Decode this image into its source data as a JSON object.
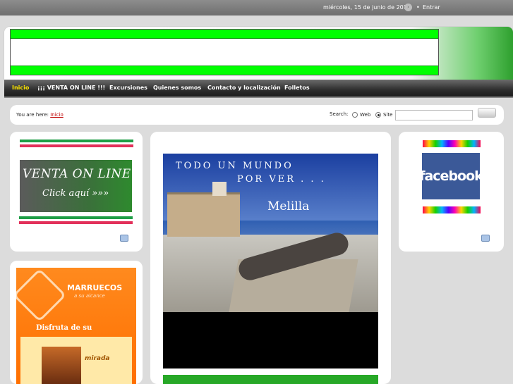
{
  "topbar": {
    "date": "miércoles, 15 de junio de 2011",
    "arrow_glyph": "›",
    "bullet": "•",
    "login": "Entrar"
  },
  "nav": {
    "items": [
      "Inicio",
      "¡¡¡ VENTA ON LINE !!!",
      "Excursiones",
      "Quienes somos",
      "Contacto y localización",
      "Folletos"
    ]
  },
  "breadcrumb": {
    "prefix": "You are here:",
    "current": "Inicio"
  },
  "search": {
    "label": "Search:",
    "option_web": "Web",
    "option_site": "Site",
    "selected": "Site",
    "value": "",
    "placeholder": ""
  },
  "left_module": {
    "banner_line1": "VENTA ON LINE",
    "banner_line2": "Click aquí »»»",
    "flag_colors": [
      "#1e9e46",
      "#ffffff",
      "#e2305a"
    ]
  },
  "center": {
    "photo_line1": "TODO UN MUNDO",
    "photo_line2": "POR VER . . .",
    "photo_line3": "Melilla"
  },
  "right_module": {
    "facebook_label": "facebook"
  },
  "promo": {
    "title": "MARRUECOS",
    "subtitle": "a su alcance",
    "line": "Disfruta de su",
    "word": "mirada"
  },
  "colors": {
    "accent_green": "#00ff00",
    "nav_active": "#ffe800",
    "link_red": "#c00000",
    "facebook_blue": "#3b5998"
  }
}
